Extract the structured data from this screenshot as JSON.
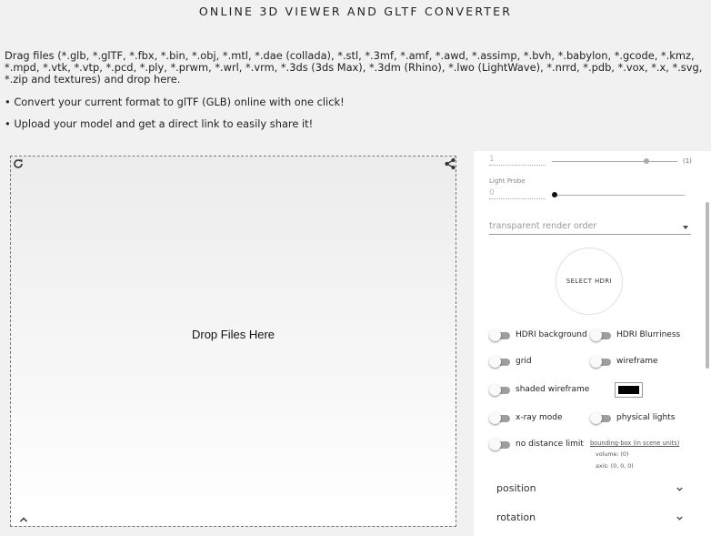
{
  "header": {
    "title": "ONLINE 3D VIEWER AND GLTF CONVERTER",
    "intro": "Drag files (*.glb, *.glTF, *.fbx, *.bin, *.obj, *.mtl, *.dae (collada), *.stl, *.3mf, *.amf, *.awd, *.assimp, *.bvh, *.babylon, *.gcode, *.kmz, *.mpd, *.vtk, *.vtp, *.pcd, *.ply, *.prwm, *.wrl, *.vrm, *.3ds (3ds Max), *.3dm (Rhino), *.lwo (LightWave), *.nrrd, *.pdb, *.vox, *.x, *.svg, *.zip and textures) and drop here.",
    "bullets": [
      "• Convert your current format to glTF (GLB) online with one click!",
      "• Upload your model and get a direct link to easily share it!"
    ]
  },
  "viewer": {
    "drop_text": "Drop Files Here",
    "icons": [
      "refresh-icon",
      "share-icon",
      "chevron-up-icon"
    ]
  },
  "panel": {
    "slider1": {
      "value": "1",
      "value_tag": "(1)",
      "level": 0.75
    },
    "light_probe": {
      "label": "Light Probe",
      "value": "0",
      "level": 0
    },
    "render_order": {
      "placeholder": "transparent render order"
    },
    "hdri_button": "SELECT HDRI",
    "toggles": {
      "hdri_background": "HDRI background",
      "hdri_blurriness": "HDRI Blurriness",
      "grid": "grid",
      "wireframe": "wireframe",
      "shaded_wireframe": "shaded wireframe",
      "xray": "x-ray mode",
      "physical_lights": "physical lights",
      "no_distance_limit": "no distance limit"
    },
    "wire_color": "#000000",
    "bounding_box": {
      "link": "bounding-box (in scene units)",
      "volume": "volume: (0)",
      "axis": "axis: (0, 0, 0)"
    },
    "sections": [
      "position",
      "rotation"
    ]
  },
  "colors": {
    "accent": "#222222",
    "toggle_track": "#9e9e9e",
    "panel_bg": "#ffffff",
    "page_bg": "#f1f1f1"
  }
}
